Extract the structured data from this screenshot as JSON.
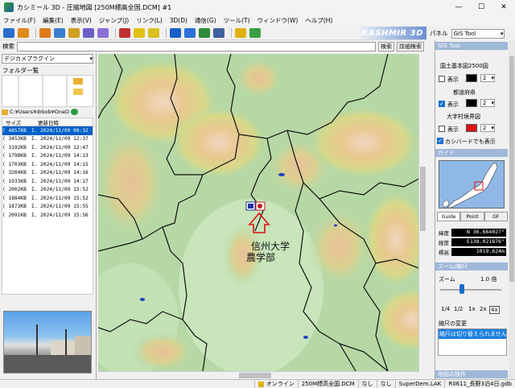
{
  "window": {
    "title": "カシミール 3D - 圧縮地図 [250M標高全国.DCM] #1",
    "minimize": "—",
    "maximize": "☐",
    "close": "✕"
  },
  "menu": [
    "ファイル(F)",
    "編集(E)",
    "表示(V)",
    "ジャンプ(J)",
    "リンク(L)",
    "3D(D)",
    "通信(G)",
    "ツール(T)",
    "ウィンドウ(W)",
    "ヘルプ(H)"
  ],
  "toolbar": {
    "brand": "KASHMIR 3D",
    "icon_colors": [
      "#2a6ed0",
      "#e08a1a",
      "#e07a1a",
      "#3a7fd0",
      "#d0a020",
      "#6a5fc8",
      "#8a6fd8",
      "#c03030",
      "#e0c010",
      "#d8c020",
      "#1a5fc8",
      "#2a70d8",
      "#2a8a3a",
      "#4060a0",
      "#e0b010",
      "#3aa040"
    ]
  },
  "search": {
    "label": "検索",
    "value": "",
    "search_button": "検索",
    "detail_button": "詳細検索"
  },
  "left_panel": {
    "plugin": "デジカメプラグイン",
    "folder_title": "フォルダ一覧",
    "path": "C:¥Users¥drkob¥OneD",
    "columns": [
      "サイズ",
      "更新日時"
    ],
    "rows": [
      {
        "size": "( 4857KB",
        "date": "I. 2024/11/09 08:32",
        "selected": true
      },
      {
        "size": "( 3453KB",
        "date": "I. 2024/11/09 12:37"
      },
      {
        "size": "( 3192KB",
        "date": "I. 2024/11/09 12:47"
      },
      {
        "size": "( 1798KB",
        "date": "I. 2024/11/09 14:13"
      },
      {
        "size": "( 1703KB",
        "date": "I. 2024/11/09 14:15"
      },
      {
        "size": "( 3204KB",
        "date": "I. 2024/11/09 14:16"
      },
      {
        "size": "( 1933KB",
        "date": "I. 2024/11/09 14:17"
      },
      {
        "size": "( 2002KB",
        "date": "I. 2024/11/09 15:52"
      },
      {
        "size": "( 1884KB",
        "date": "I. 2024/11/09 15:52"
      },
      {
        "size": "( 1873KB",
        "date": "I. 2024/11/09 15:55"
      },
      {
        "size": "( 2091KB",
        "date": "I. 2024/11/09 15:56"
      }
    ]
  },
  "map": {
    "label_line1": "信州大学",
    "label_line2": "農学部"
  },
  "right_panel": {
    "panel_label": "パネル",
    "panel_value": "GIS Tool",
    "gis_head": "GIS Tool",
    "layers": [
      {
        "name": "国土基本図2500図",
        "show": "表示",
        "checked": false,
        "color": "#000000",
        "width": "2"
      },
      {
        "name": "都道府県",
        "show": "表示",
        "checked": true,
        "color": "#000000",
        "width": "2"
      },
      {
        "name": "大字村境界図",
        "show": "表示",
        "checked": false,
        "color": "#e01010",
        "width": "2"
      }
    ],
    "kashbird": "カシバードでも表示",
    "guide_head": "ガイド",
    "guide_tabs": [
      "Guide",
      "Point",
      "GF"
    ],
    "coords": [
      {
        "k": "緯度",
        "v": "N 36.664027°"
      },
      {
        "k": "経度",
        "v": "E138.021876°"
      },
      {
        "k": "標高",
        "v": "1019.624m"
      }
    ],
    "zoom_head": "ズーム/縮尺",
    "zoom_label": "ズーム",
    "zoom_value": "1.0 倍",
    "zoom_buttons": [
      "1/4",
      "1/2",
      "1x",
      "2x",
      "4x"
    ],
    "scale_head": "縮尺の変更",
    "scale_text": "縮尺は切り替えられません",
    "bottom_head": "地図の操作"
  },
  "status": {
    "online": "オンライン",
    "map": "250M標高全国.DCM",
    "none1": "なし",
    "none2": "なし",
    "dem": "SuperDem.LAK",
    "gdb": "R0611_長野3泊4日.gdb"
  }
}
